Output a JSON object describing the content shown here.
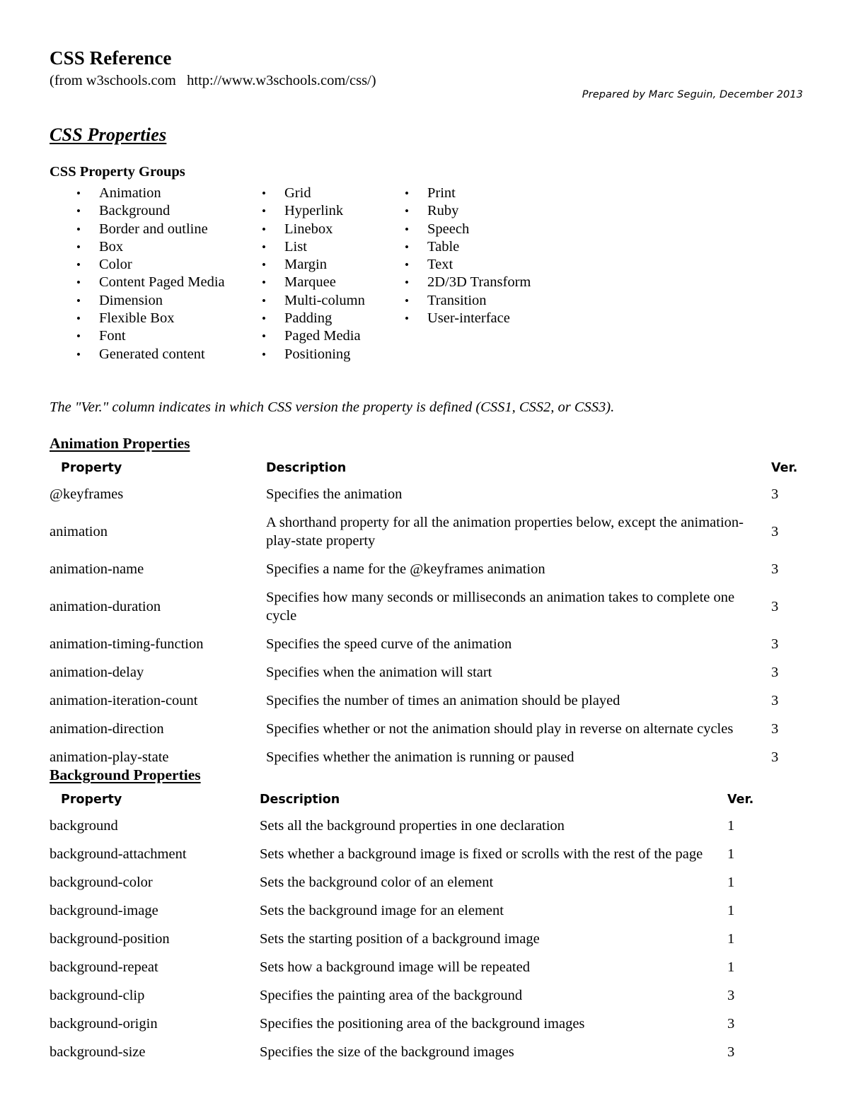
{
  "header": {
    "title": "CSS Reference",
    "source": "(from w3schools.com   http://www.w3schools.com/css/)",
    "prepared_by": "Prepared by Marc Seguin, December 2013"
  },
  "main_section": {
    "title": "CSS Properties"
  },
  "property_groups": {
    "title": "CSS Property Groups",
    "bullet": "•",
    "columns": [
      [
        "Animation",
        "Background",
        "Border and outline",
        "Box",
        "Color",
        "Content Paged Media",
        "Dimension",
        "Flexible Box",
        "Font",
        "Generated content"
      ],
      [
        "Grid",
        "Hyperlink",
        "Linebox",
        "List",
        "Margin",
        "Marquee",
        "Multi-column",
        "Padding",
        "Paged Media",
        "Positioning"
      ],
      [
        "Print",
        "Ruby",
        "Speech",
        "Table",
        "Text",
        "2D/3D Transform",
        "Transition",
        "User-interface"
      ]
    ]
  },
  "ver_note": "The \"Ver.\" column indicates in which CSS version the property is defined (CSS1, CSS2, or CSS3).",
  "tables": [
    {
      "title": "Animation Properties",
      "headers": {
        "property": "Property",
        "description": "Description",
        "ver": "Ver."
      },
      "rows": [
        {
          "property": "@keyframes",
          "description": "Specifies the animation",
          "ver": "3"
        },
        {
          "property": "animation",
          "description": "A shorthand property for all the animation properties below, except the animation-play-state property",
          "ver": "3"
        },
        {
          "property": "animation-name",
          "description": "Specifies a name for the @keyframes animation",
          "ver": "3"
        },
        {
          "property": "animation-duration",
          "description": "Specifies how many seconds or milliseconds an animation takes to complete one cycle",
          "ver": "3"
        },
        {
          "property": "animation-timing-function",
          "description": "Specifies the speed curve of the animation",
          "ver": "3"
        },
        {
          "property": "animation-delay",
          "description": "Specifies when the animation will start",
          "ver": "3"
        },
        {
          "property": "animation-iteration-count",
          "description": "Specifies the number of times an animation should be played",
          "ver": "3"
        },
        {
          "property": "animation-direction",
          "description": "Specifies whether or not the animation should play in reverse on alternate cycles",
          "ver": "3"
        },
        {
          "property": "animation-play-state",
          "description": "Specifies whether the animation is running or paused",
          "ver": "3"
        }
      ]
    },
    {
      "title": "Background Properties",
      "headers": {
        "property": "Property",
        "description": "Description",
        "ver": "Ver."
      },
      "rows": [
        {
          "property": "background",
          "description": "Sets all the background properties in one declaration",
          "ver": "1"
        },
        {
          "property": "background-attachment",
          "description": "Sets whether a background image is fixed or scrolls with the rest of the page",
          "ver": "1"
        },
        {
          "property": "background-color",
          "description": "Sets the background color of an element",
          "ver": "1"
        },
        {
          "property": "background-image",
          "description": "Sets the background image for an element",
          "ver": "1"
        },
        {
          "property": "background-position",
          "description": "Sets the starting position of a background image",
          "ver": "1"
        },
        {
          "property": "background-repeat",
          "description": "Sets how a background image will be repeated",
          "ver": "1"
        },
        {
          "property": "background-clip",
          "description": "Specifies the painting area of the background",
          "ver": "3"
        },
        {
          "property": "background-origin",
          "description": "Specifies the positioning area of the background images",
          "ver": "3"
        },
        {
          "property": "background-size",
          "description": "Specifies the size of the background images",
          "ver": "3"
        }
      ]
    }
  ]
}
